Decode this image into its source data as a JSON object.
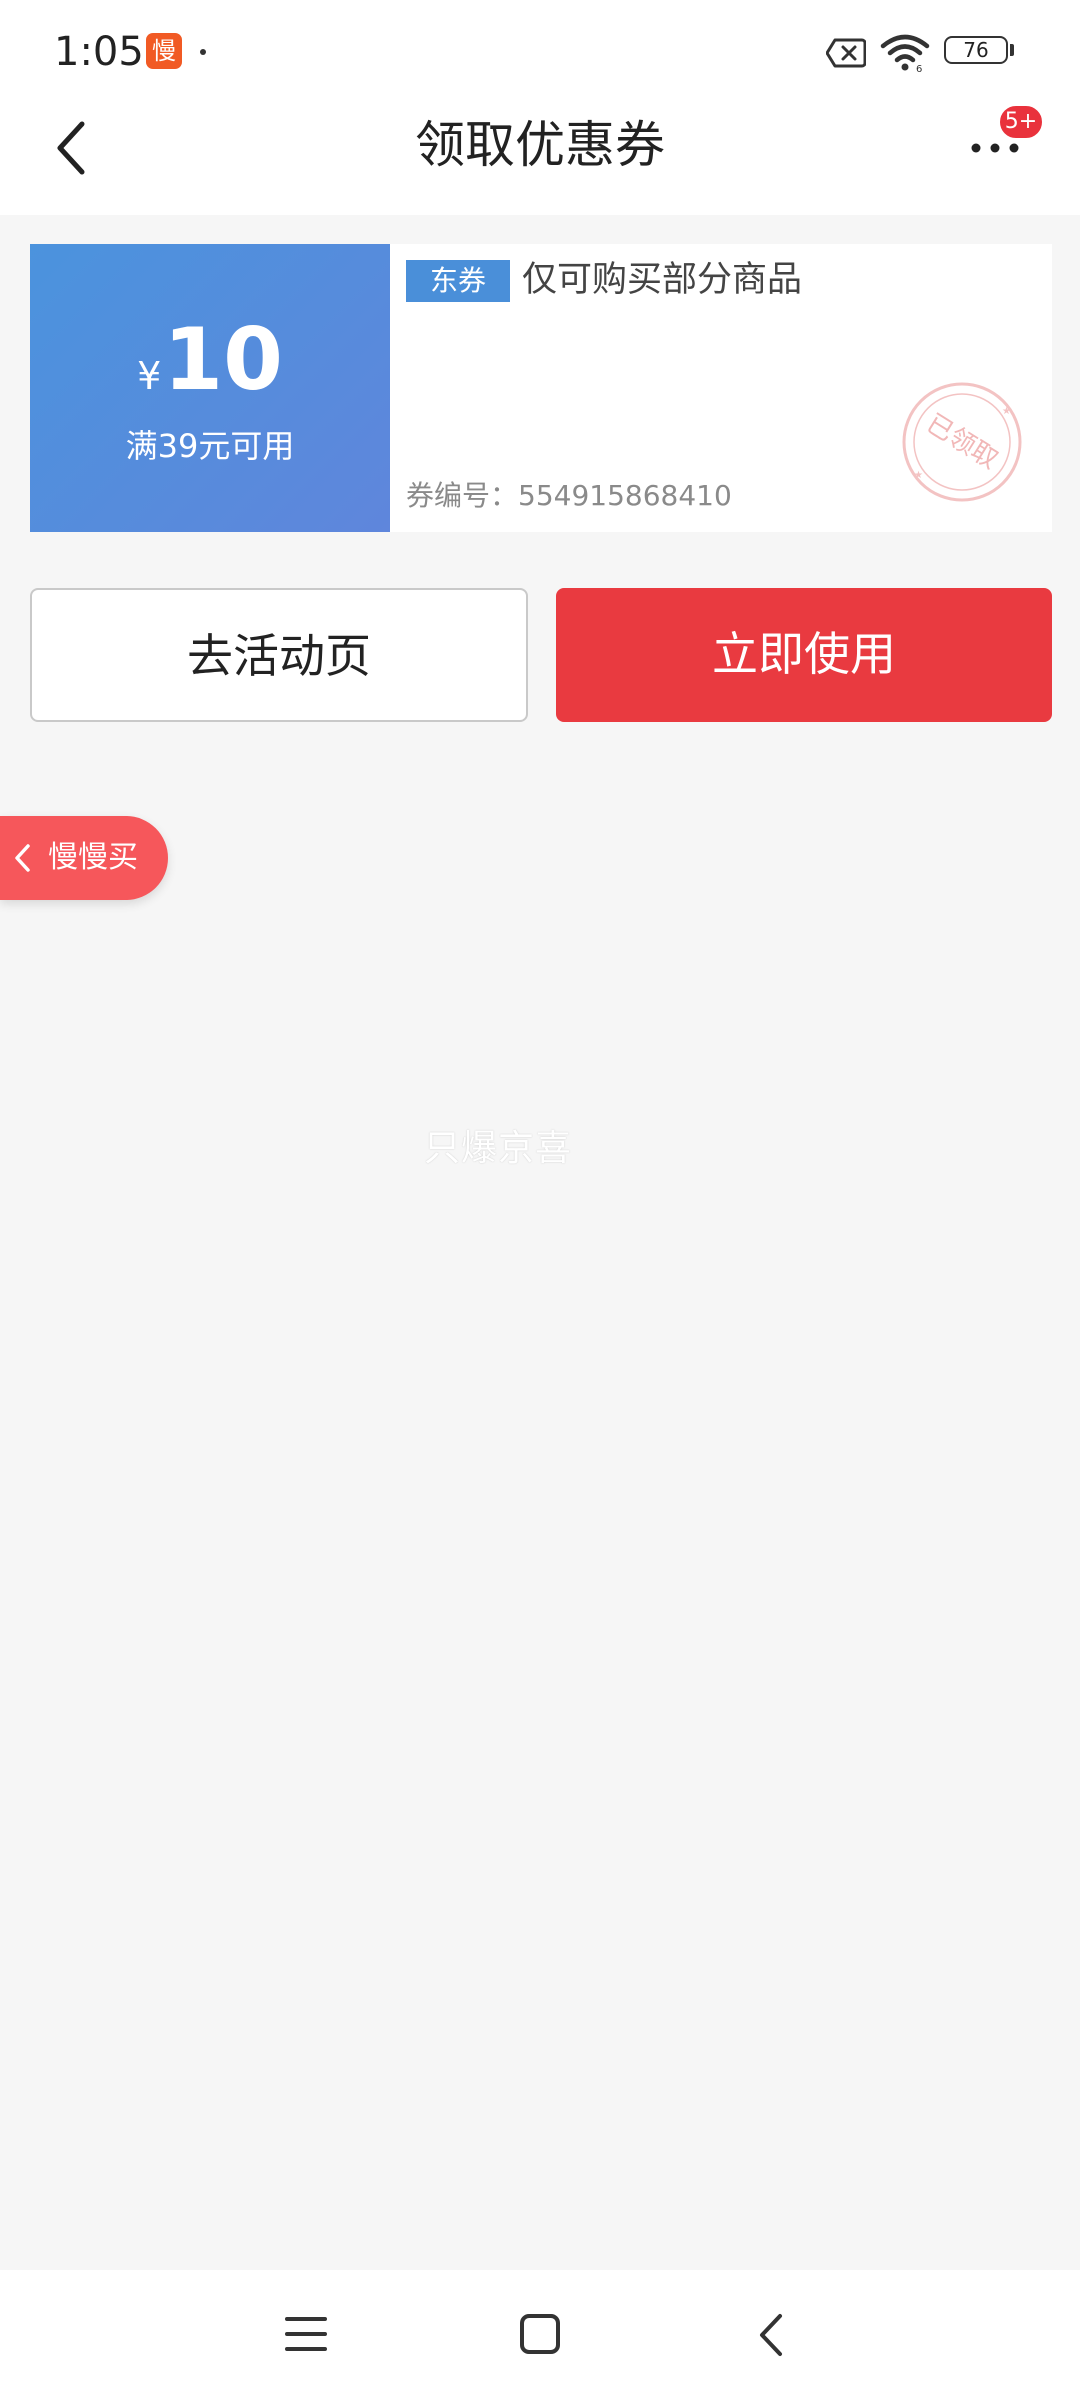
{
  "status_bar": {
    "time": "1:05",
    "app_badge": "慢",
    "battery_level": 76,
    "battery_text": "76"
  },
  "nav": {
    "title": "领取优惠券",
    "more_badge": "5+"
  },
  "coupon": {
    "currency": "¥",
    "value": "10",
    "condition": "满39元可用",
    "tag": "东券",
    "description": "仅可购买部分商品",
    "code_text": "券编号：554915868410",
    "stamp_text": "已领取"
  },
  "buttons": {
    "activity_label": "去活动页",
    "use_label": "立即使用"
  },
  "float_tab": {
    "label": "慢慢买"
  },
  "watermark": "只爆京喜",
  "colors": {
    "accent_red": "#e93a40",
    "coupon_blue": "#4b93dd",
    "float_tab": "#f6575b",
    "stamp": "#f1b7b7"
  }
}
